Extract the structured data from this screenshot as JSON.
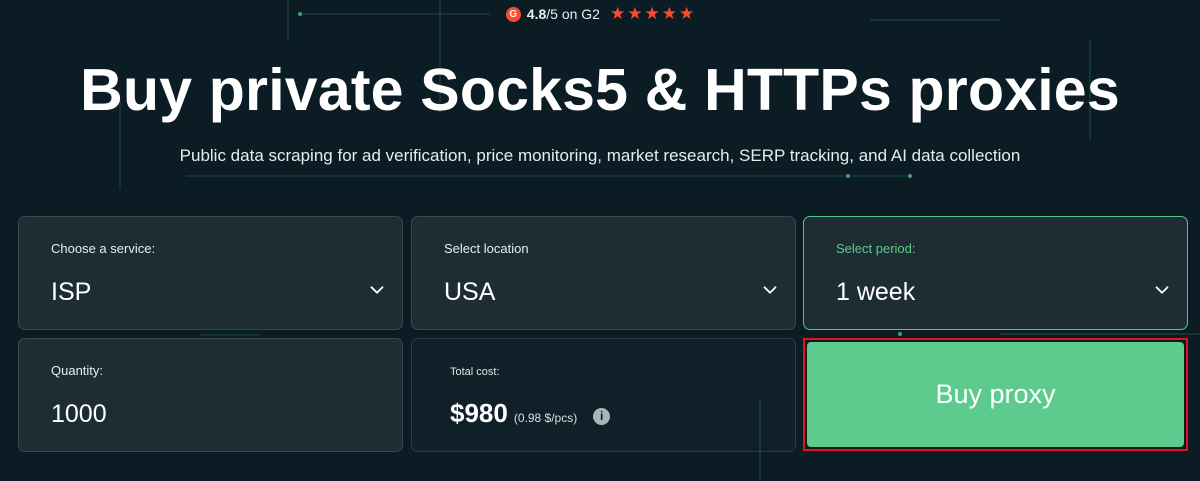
{
  "rating": {
    "logo_letter": "G",
    "score": "4.8",
    "suffix": "/5 on G2",
    "stars": [
      "★",
      "★",
      "★",
      "★",
      "★"
    ],
    "star_color": "#ff492c"
  },
  "hero": {
    "title": "Buy private Socks5 & HTTPs proxies",
    "subtitle": "Public data scraping for ad verification, price monitoring, market research, SERP tracking, and AI data collection"
  },
  "form": {
    "service": {
      "label": "Choose a service:",
      "value": "ISP",
      "icon": "chevron-down-icon"
    },
    "location": {
      "label": "Select location",
      "value": "USA",
      "icon": "chevron-down-icon"
    },
    "period": {
      "label": "Select period:",
      "value": "1 week",
      "icon": "chevron-down-icon",
      "active": true
    },
    "quantity": {
      "label": "Quantity:",
      "value": "1000"
    },
    "total": {
      "label": "Total cost:",
      "price": "$980",
      "per_unit": "(0.98 $/pcs)",
      "info_icon": "i"
    },
    "buy_button": {
      "label": "Buy proxy"
    }
  },
  "colors": {
    "background": "#0c1c24",
    "accent": "#5ccb8d",
    "highlight_border": "#e0151b"
  }
}
